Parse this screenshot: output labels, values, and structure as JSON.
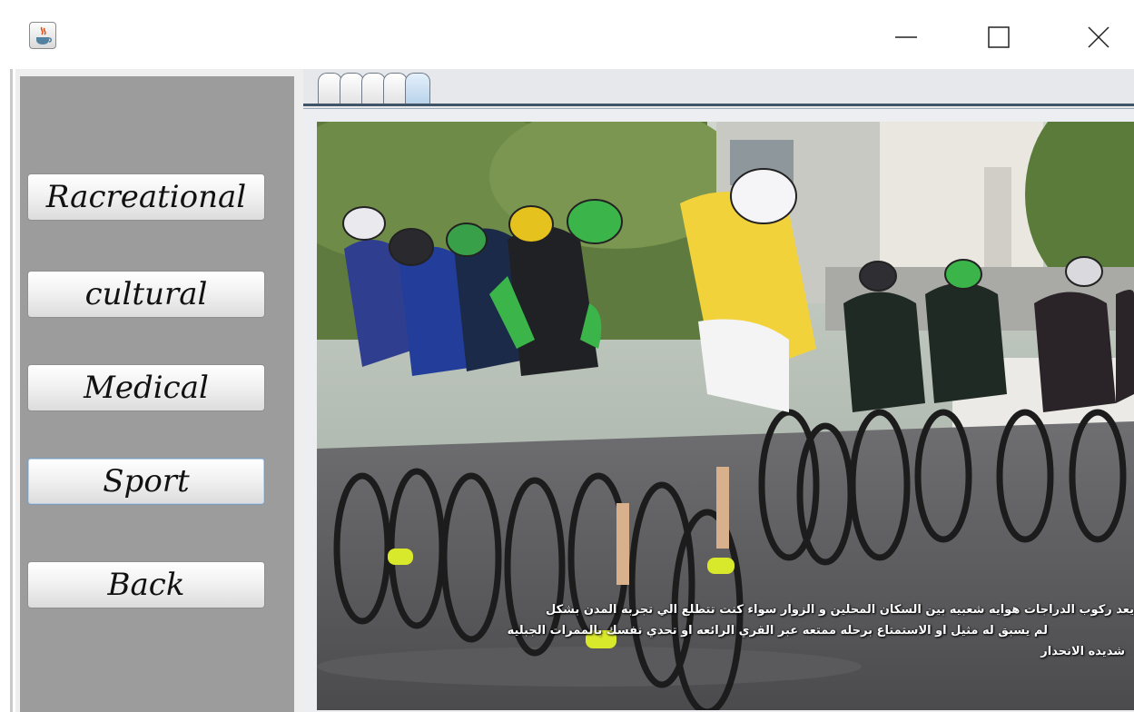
{
  "window": {
    "app_icon": "java-coffee-cup-icon",
    "controls": [
      "minimize-icon",
      "maximize-icon",
      "close-icon"
    ]
  },
  "sidebar": {
    "items": [
      {
        "label": "Racreational"
      },
      {
        "label": "cultural"
      },
      {
        "label": "Medical"
      },
      {
        "label": "Sport",
        "selected": true
      },
      {
        "label": "Back"
      }
    ]
  },
  "tabs": {
    "count": 5,
    "active_index": 4
  },
  "content": {
    "image_subject": "cyclists racing on road",
    "caption_lines": [
      "يعد ركوب الدراجات  هوايه شعبيه بين السكان المحلين و الزوار سواء كنت تتطلع الي تجربه المدن بشكل",
      "لم يسبق له مثيل او الاستمتاع برحله ممتعه عبر القري الرائعه او تحدي نفسك بالممرات الجبليه",
      "شديده الانحدار"
    ]
  },
  "colors": {
    "sidebar_bg": "#9c9c9c",
    "tab_line": "#3f5467",
    "jersey_yellow": "#f2d23a"
  }
}
